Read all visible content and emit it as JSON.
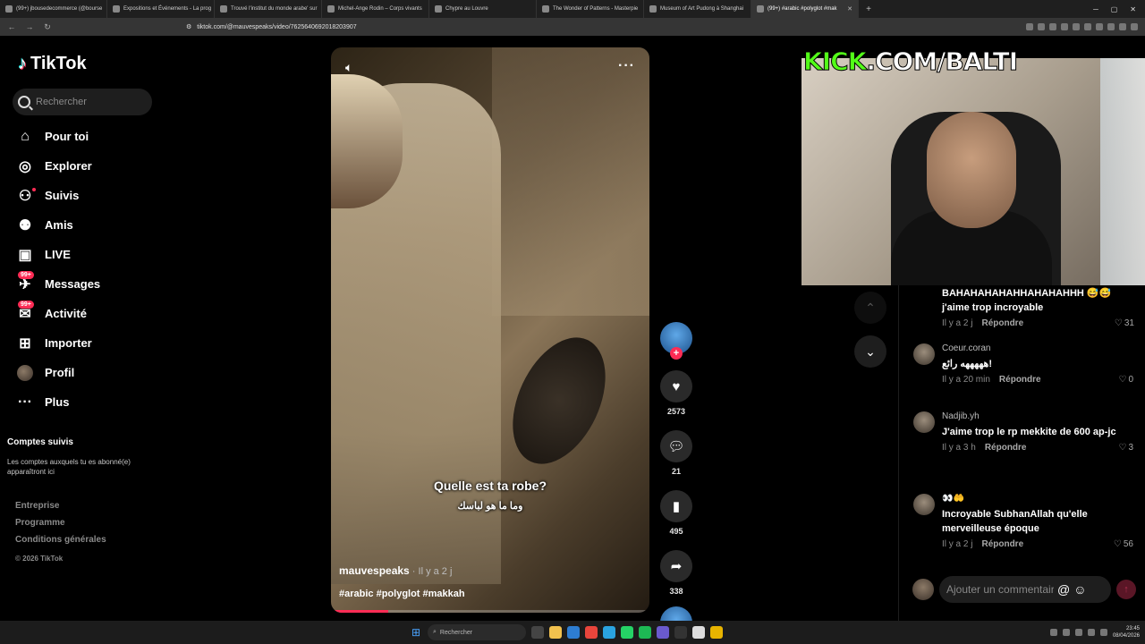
{
  "browser": {
    "tabs": [
      {
        "title": "(99+) jbousedecommerce (@bourse"
      },
      {
        "title": "Expositions et Événements - La prog"
      },
      {
        "title": "Trouvé l'institut du monde arabe' sur"
      },
      {
        "title": "Michel-Ange Rodin – Corps vivants"
      },
      {
        "title": "Chypre au Louvre"
      },
      {
        "title": "The Wonder of Patterns - Masterpie"
      },
      {
        "title": "Museum of Art Pudong à Shanghai"
      },
      {
        "title": "(99+) #arabic #polyglot #mak"
      }
    ],
    "url": "tiktok.com/@mauvespeaks/video/7625640692018203907"
  },
  "sidebar": {
    "logo": "TikTok",
    "search_placeholder": "Rechercher",
    "nav": [
      {
        "label": "Pour toi",
        "icon": "home-icon"
      },
      {
        "label": "Explorer",
        "icon": "compass-icon"
      },
      {
        "label": "Suivis",
        "icon": "following-icon"
      },
      {
        "label": "Amis",
        "icon": "friends-icon"
      },
      {
        "label": "LIVE",
        "icon": "live-icon"
      },
      {
        "label": "Messages",
        "icon": "messages-icon",
        "badge": "99+"
      },
      {
        "label": "Activité",
        "icon": "activity-icon",
        "badge": "99+"
      },
      {
        "label": "Importer",
        "icon": "upload-icon"
      },
      {
        "label": "Profil",
        "icon": "profile-avatar"
      },
      {
        "label": "Plus",
        "icon": "more-icon"
      }
    ],
    "followed_title": "Comptes suivis",
    "followed_desc": "Les comptes auxquels tu es abonné(e) apparaîtront ici",
    "footer": [
      "Entreprise",
      "Programme",
      "Conditions générales"
    ],
    "copyright": "© 2026 TikTok"
  },
  "video": {
    "caption_fr": "Quelle est ta robe?",
    "caption_ar": "وما ما هو لباسك",
    "author": "mauvespeaks",
    "time": " · Il y a 2 j",
    "tags": "#arabic #polyglot #makkah",
    "progress": 0.18
  },
  "actions": {
    "likes": "2573",
    "comments": "21",
    "saves": "495",
    "shares": "338"
  },
  "overlay": {
    "kick": "KICK",
    "rest": ".COM/BALTI"
  },
  "comments": {
    "partial_top": "BAHAHAHAHAHHAHAHAHHH 😅😅 j'aime trop incroyable",
    "partial_meta": {
      "time": "Il y a 2 j",
      "reply": "Répondre",
      "likes": "31"
    },
    "items": [
      {
        "user": "Coeur.coran",
        "text": "هههههه رائع!",
        "time": "Il y a 20 min",
        "reply": "Répondre",
        "likes": "0"
      },
      {
        "user": "Nadjib.yh",
        "text": "J'aime trop le rp mekkite de 600 ap-jc",
        "time": "Il y a 3 h",
        "reply": "Répondre",
        "likes": "3"
      },
      {
        "user": "👀🤲",
        "text": "Incroyable SubhanAllah qu'elle merveilleuse époque",
        "time": "Il y a 2 j",
        "reply": "Répondre",
        "likes": "56"
      }
    ],
    "input_placeholder": "Ajouter un commentaire..."
  },
  "taskbar": {
    "search": "Rechercher",
    "time": "23:45",
    "date": "08/04/2026"
  }
}
